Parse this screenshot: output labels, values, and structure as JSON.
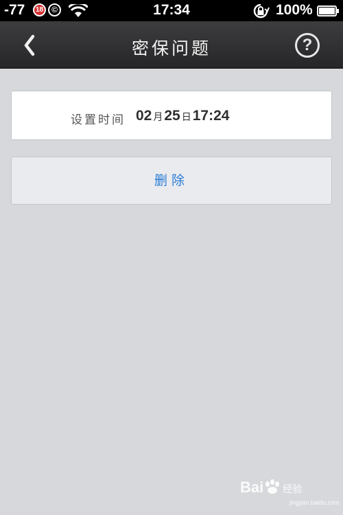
{
  "status_bar": {
    "signal": "-77",
    "badge": "18",
    "copyright": "©",
    "time": "17:34",
    "battery": "100%"
  },
  "nav": {
    "title": "密保问题",
    "help": "?"
  },
  "time_card": {
    "label": "设置时间",
    "month": "02",
    "month_unit": "月",
    "day": "25",
    "day_unit": "日",
    "clock": "17:24"
  },
  "delete_label": "删除",
  "watermark": {
    "brand_left": "Bai",
    "brand_right": "经验",
    "url": "jingyan.baidu.com"
  },
  "colors": {
    "status_bg": "#000000",
    "nav_bg": "#2f2f31",
    "page_bg": "#d6d8db",
    "card_bg": "#ffffff",
    "button_bg": "#e9ebee",
    "accent": "#2a7bd6"
  }
}
